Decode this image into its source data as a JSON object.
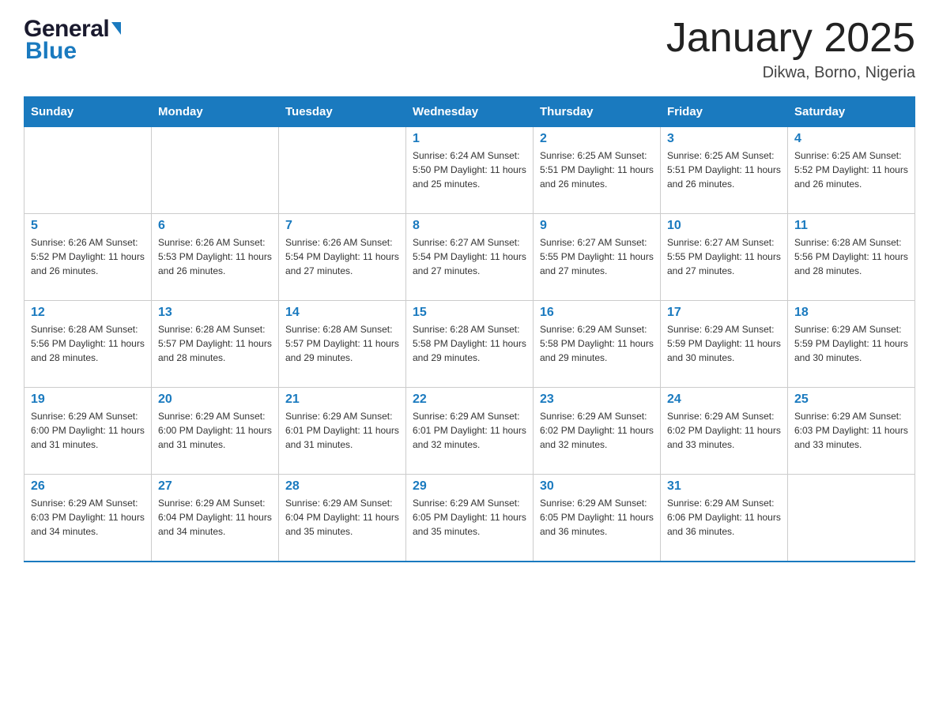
{
  "header": {
    "logo_general": "General",
    "logo_blue": "Blue",
    "month_title": "January 2025",
    "location": "Dikwa, Borno, Nigeria"
  },
  "days_of_week": [
    "Sunday",
    "Monday",
    "Tuesday",
    "Wednesday",
    "Thursday",
    "Friday",
    "Saturday"
  ],
  "weeks": [
    [
      {
        "day": "",
        "info": ""
      },
      {
        "day": "",
        "info": ""
      },
      {
        "day": "",
        "info": ""
      },
      {
        "day": "1",
        "info": "Sunrise: 6:24 AM\nSunset: 5:50 PM\nDaylight: 11 hours and 25 minutes."
      },
      {
        "day": "2",
        "info": "Sunrise: 6:25 AM\nSunset: 5:51 PM\nDaylight: 11 hours and 26 minutes."
      },
      {
        "day": "3",
        "info": "Sunrise: 6:25 AM\nSunset: 5:51 PM\nDaylight: 11 hours and 26 minutes."
      },
      {
        "day": "4",
        "info": "Sunrise: 6:25 AM\nSunset: 5:52 PM\nDaylight: 11 hours and 26 minutes."
      }
    ],
    [
      {
        "day": "5",
        "info": "Sunrise: 6:26 AM\nSunset: 5:52 PM\nDaylight: 11 hours and 26 minutes."
      },
      {
        "day": "6",
        "info": "Sunrise: 6:26 AM\nSunset: 5:53 PM\nDaylight: 11 hours and 26 minutes."
      },
      {
        "day": "7",
        "info": "Sunrise: 6:26 AM\nSunset: 5:54 PM\nDaylight: 11 hours and 27 minutes."
      },
      {
        "day": "8",
        "info": "Sunrise: 6:27 AM\nSunset: 5:54 PM\nDaylight: 11 hours and 27 minutes."
      },
      {
        "day": "9",
        "info": "Sunrise: 6:27 AM\nSunset: 5:55 PM\nDaylight: 11 hours and 27 minutes."
      },
      {
        "day": "10",
        "info": "Sunrise: 6:27 AM\nSunset: 5:55 PM\nDaylight: 11 hours and 27 minutes."
      },
      {
        "day": "11",
        "info": "Sunrise: 6:28 AM\nSunset: 5:56 PM\nDaylight: 11 hours and 28 minutes."
      }
    ],
    [
      {
        "day": "12",
        "info": "Sunrise: 6:28 AM\nSunset: 5:56 PM\nDaylight: 11 hours and 28 minutes."
      },
      {
        "day": "13",
        "info": "Sunrise: 6:28 AM\nSunset: 5:57 PM\nDaylight: 11 hours and 28 minutes."
      },
      {
        "day": "14",
        "info": "Sunrise: 6:28 AM\nSunset: 5:57 PM\nDaylight: 11 hours and 29 minutes."
      },
      {
        "day": "15",
        "info": "Sunrise: 6:28 AM\nSunset: 5:58 PM\nDaylight: 11 hours and 29 minutes."
      },
      {
        "day": "16",
        "info": "Sunrise: 6:29 AM\nSunset: 5:58 PM\nDaylight: 11 hours and 29 minutes."
      },
      {
        "day": "17",
        "info": "Sunrise: 6:29 AM\nSunset: 5:59 PM\nDaylight: 11 hours and 30 minutes."
      },
      {
        "day": "18",
        "info": "Sunrise: 6:29 AM\nSunset: 5:59 PM\nDaylight: 11 hours and 30 minutes."
      }
    ],
    [
      {
        "day": "19",
        "info": "Sunrise: 6:29 AM\nSunset: 6:00 PM\nDaylight: 11 hours and 31 minutes."
      },
      {
        "day": "20",
        "info": "Sunrise: 6:29 AM\nSunset: 6:00 PM\nDaylight: 11 hours and 31 minutes."
      },
      {
        "day": "21",
        "info": "Sunrise: 6:29 AM\nSunset: 6:01 PM\nDaylight: 11 hours and 31 minutes."
      },
      {
        "day": "22",
        "info": "Sunrise: 6:29 AM\nSunset: 6:01 PM\nDaylight: 11 hours and 32 minutes."
      },
      {
        "day": "23",
        "info": "Sunrise: 6:29 AM\nSunset: 6:02 PM\nDaylight: 11 hours and 32 minutes."
      },
      {
        "day": "24",
        "info": "Sunrise: 6:29 AM\nSunset: 6:02 PM\nDaylight: 11 hours and 33 minutes."
      },
      {
        "day": "25",
        "info": "Sunrise: 6:29 AM\nSunset: 6:03 PM\nDaylight: 11 hours and 33 minutes."
      }
    ],
    [
      {
        "day": "26",
        "info": "Sunrise: 6:29 AM\nSunset: 6:03 PM\nDaylight: 11 hours and 34 minutes."
      },
      {
        "day": "27",
        "info": "Sunrise: 6:29 AM\nSunset: 6:04 PM\nDaylight: 11 hours and 34 minutes."
      },
      {
        "day": "28",
        "info": "Sunrise: 6:29 AM\nSunset: 6:04 PM\nDaylight: 11 hours and 35 minutes."
      },
      {
        "day": "29",
        "info": "Sunrise: 6:29 AM\nSunset: 6:05 PM\nDaylight: 11 hours and 35 minutes."
      },
      {
        "day": "30",
        "info": "Sunrise: 6:29 AM\nSunset: 6:05 PM\nDaylight: 11 hours and 36 minutes."
      },
      {
        "day": "31",
        "info": "Sunrise: 6:29 AM\nSunset: 6:06 PM\nDaylight: 11 hours and 36 minutes."
      },
      {
        "day": "",
        "info": ""
      }
    ]
  ]
}
